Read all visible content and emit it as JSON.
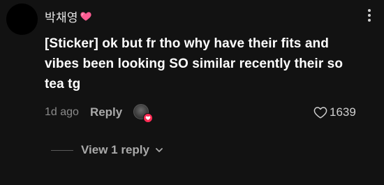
{
  "comment": {
    "username": "박채영",
    "username_emoji_icon": "pink-heart-icon",
    "text": "[Sticker] ok but fr tho why have their fits and vibes been looking SO similar recently their so tea tg",
    "time": "1d ago",
    "reply_label": "Reply",
    "like_count": "1639"
  },
  "replies": {
    "view_label": "View 1 reply"
  },
  "colors": {
    "background": "#121212",
    "text_primary": "#ffffff",
    "text_muted": "#8a8a8a",
    "heart_accent": "#fe2c55"
  }
}
